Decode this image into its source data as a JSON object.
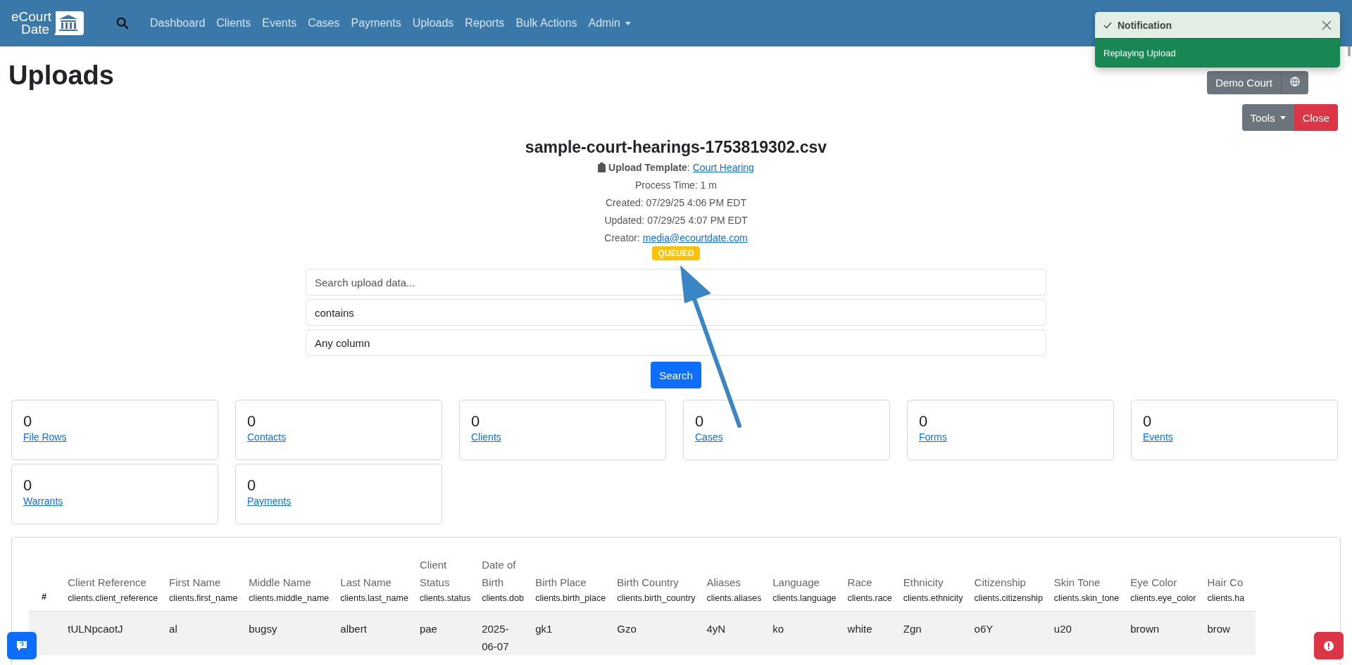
{
  "navbar": {
    "logo_text": [
      "eCourt",
      "Date"
    ],
    "items": [
      {
        "label": "Dashboard",
        "selected": false
      },
      {
        "label": "Clients",
        "selected": false
      },
      {
        "label": "Events",
        "selected": false
      },
      {
        "label": "Cases",
        "selected": false
      },
      {
        "label": "Payments",
        "selected": false
      },
      {
        "label": "Uploads",
        "selected": false
      },
      {
        "label": "Reports",
        "selected": false
      },
      {
        "label": "Bulk Actions",
        "selected": false
      },
      {
        "label": "Admin",
        "selected": false,
        "dropdown": true
      }
    ]
  },
  "page_title": "Uploads",
  "agency_button": "Demo Court",
  "toast": {
    "title": "Notification",
    "message": "Replaying Upload"
  },
  "actions": {
    "tools": "Tools",
    "close": "Close"
  },
  "upload": {
    "filename": "sample-court-hearings-1753819302.csv",
    "template_label": "**Upload Template**:",
    "template_value": "Court Hearing",
    "process_time": "Process Time: 1 m",
    "created": "Created: 07/29/25 4:06 PM EDT",
    "updated": "Updated: 07/29/25 4:07 PM EDT",
    "creator_label": "Creator:",
    "creator_value": "media@ecourtdate.com",
    "status": "QUEUED"
  },
  "search": {
    "placeholder": "Search upload data...",
    "operator": "contains",
    "column": "Any column",
    "button": "Search"
  },
  "stats": [
    {
      "count": "0",
      "label": "File Rows"
    },
    {
      "count": "0",
      "label": "Contacts"
    },
    {
      "count": "0",
      "label": "Clients"
    },
    {
      "count": "0",
      "label": "Cases"
    },
    {
      "count": "0",
      "label": "Forms"
    },
    {
      "count": "0",
      "label": "Events"
    },
    {
      "count": "0",
      "label": "Warrants"
    },
    {
      "count": "0",
      "label": "Payments"
    }
  ],
  "table": {
    "columns": [
      {
        "label": "#"
      },
      {
        "label": "Client Reference",
        "key": "clients.client_reference"
      },
      {
        "label": "First Name",
        "key": "clients.first_name"
      },
      {
        "label": "Middle Name",
        "key": "clients.middle_name"
      },
      {
        "label": "Last Name",
        "key": "clients.last_name"
      },
      {
        "label": "Client Status",
        "key": "clients.status"
      },
      {
        "label": "Date of Birth",
        "key": "clients.dob"
      },
      {
        "label": "Birth Place",
        "key": "clients.birth_place"
      },
      {
        "label": "Birth Country",
        "key": "clients.birth_country"
      },
      {
        "label": "Aliases",
        "key": "clients.aliases"
      },
      {
        "label": "Language",
        "key": "clients.language"
      },
      {
        "label": "Race",
        "key": "clients.race"
      },
      {
        "label": "Ethnicity",
        "key": "clients.ethnicity"
      },
      {
        "label": "Citizenship",
        "key": "clients.citizenship"
      },
      {
        "label": "Skin Tone",
        "key": "clients.skin_tone"
      },
      {
        "label": "Eye Color",
        "key": "clients.eye_color"
      },
      {
        "label": "Hair Co",
        "key": "clients.ha"
      }
    ],
    "rows": [
      [
        "",
        "tULNpcaotJ",
        "al",
        "bugsy",
        "albert",
        "pae",
        "2025-06-07",
        "gk1",
        "Gzo",
        "4yN",
        "ko",
        "white",
        "Zgn",
        "o6Y",
        "u20",
        "brown",
        "brow"
      ]
    ]
  }
}
